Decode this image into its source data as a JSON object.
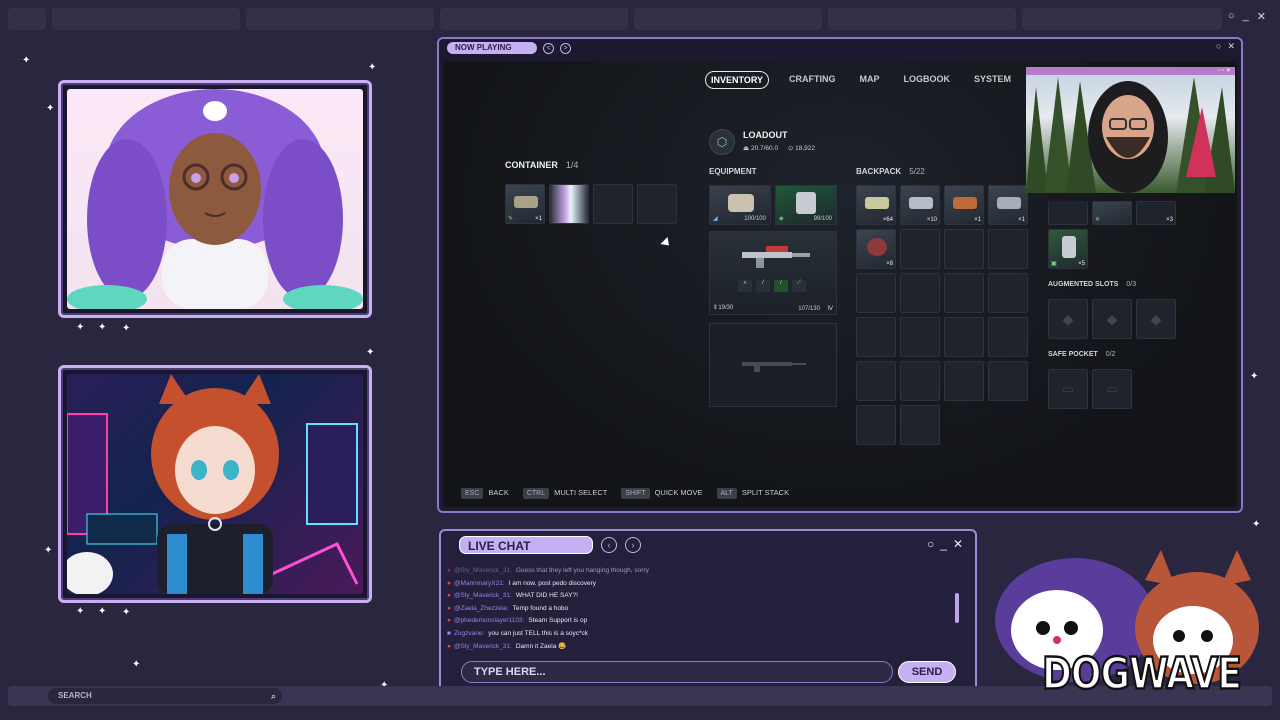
{
  "window": {
    "controls": [
      "○",
      "_",
      "✕"
    ]
  },
  "game_window": {
    "title": "NOW PLAYING",
    "nav_prev": "<",
    "nav_next": ">",
    "controls": [
      "○",
      "✕"
    ]
  },
  "game": {
    "tabs": [
      {
        "label": "INVENTORY",
        "active": true
      },
      {
        "label": "CRAFTING",
        "active": false
      },
      {
        "label": "MAP",
        "active": false
      },
      {
        "label": "LOGBOOK",
        "active": false
      },
      {
        "label": "SYSTEM",
        "active": false
      }
    ],
    "loadout": {
      "title": "LOADOUT",
      "weight": "20.7/60.0",
      "currency": "18,922"
    },
    "container": {
      "label": "CONTAINER",
      "count": "1/4",
      "slots": [
        {
          "qty": "×1",
          "filled": true
        },
        {
          "qty": "",
          "filled": true
        },
        {
          "qty": "",
          "filled": false
        },
        {
          "qty": "",
          "filled": false
        }
      ]
    },
    "equipment": {
      "label": "EQUIPMENT",
      "shield": "100/100",
      "augment": "98/100",
      "weapon_ammo": "19/30",
      "weapon_durability": "107/130"
    },
    "backpack": {
      "label": "BACKPACK",
      "count": "5/22",
      "items": [
        "×64",
        "×10",
        "×1",
        "×1",
        "×3",
        "×8",
        "×5"
      ]
    },
    "augmented_slots": {
      "label": "AUGMENTED SLOTS",
      "count": "0/3"
    },
    "safe_pocket": {
      "label": "SAFE POCKET",
      "count": "0/2"
    },
    "hints": [
      {
        "key": "ESC",
        "label": "BACK"
      },
      {
        "key": "CTRL",
        "label": "MULTI SELECT"
      },
      {
        "key": "SHIFT",
        "label": "QUICK MOVE"
      },
      {
        "key": "ALT",
        "label": "SPLIT STACK"
      }
    ]
  },
  "chat": {
    "title": "LIVE CHAT",
    "controls": [
      "○",
      "_",
      "✕"
    ],
    "messages": [
      {
        "user": "@Sly_Maverick_31:",
        "text": "Guess that they left you hanging though, sorry"
      },
      {
        "user": "@MannmaryX21:",
        "text": "I am now. post pedo discovery"
      },
      {
        "user": "@Sly_Maverick_31:",
        "text": "WHAT DID HE SAY?!"
      },
      {
        "user": "@Zaela_Zhezzeia:",
        "text": "Temp found a hobo"
      },
      {
        "user": "@phedemonslayer1103:",
        "text": "Steam Support is op"
      },
      {
        "user": "Zugzvane:",
        "text": "you can just TELL this is a soyc*ck"
      },
      {
        "user": "@Sly_Maverick_31:",
        "text": "Damn it Zaela 😂"
      }
    ],
    "input_placeholder": "TYPE HERE...",
    "send_label": "SEND"
  },
  "search": {
    "placeholder": "SEARCH"
  },
  "logo": {
    "text": "DOGWAVE"
  },
  "colors": {
    "background": "#2b2640",
    "accent": "#c4b0f3",
    "frame": "#c9b0f2",
    "username": "#9f80ea"
  }
}
